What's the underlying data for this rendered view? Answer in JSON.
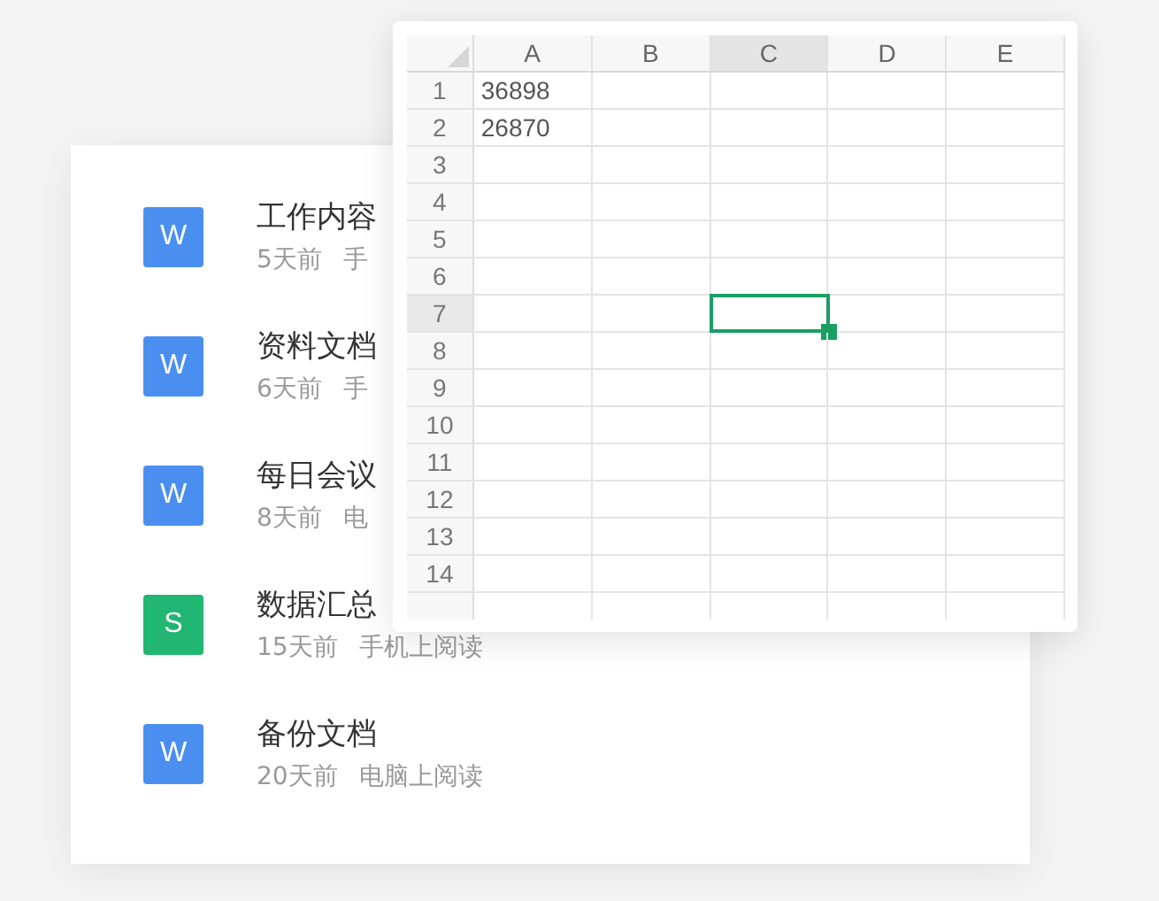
{
  "files": [
    {
      "badge": "W",
      "color": "#4a8ff0",
      "title": "工作内容",
      "time": "5天前",
      "source": "手"
    },
    {
      "badge": "W",
      "color": "#4a8ff0",
      "title": "资料文档",
      "time": "6天前",
      "source": "手"
    },
    {
      "badge": "W",
      "color": "#4a8ff0",
      "title": "每日会议",
      "time": "8天前",
      "source": "电"
    },
    {
      "badge": "S",
      "color": "#21b672",
      "title": "数据汇总",
      "time": "15天前",
      "source": "手机上阅读"
    },
    {
      "badge": "W",
      "color": "#4a8ff0",
      "title": "备份文档",
      "time": "20天前",
      "source": "电脑上阅读"
    }
  ],
  "sheet": {
    "columns": [
      {
        "label": "A",
        "selected": false
      },
      {
        "label": "B",
        "selected": false
      },
      {
        "label": "C",
        "selected": true
      },
      {
        "label": "D",
        "selected": false
      },
      {
        "label": "E",
        "selected": false
      }
    ],
    "rows": [
      {
        "label": "1",
        "selected": false,
        "cells": [
          "36898"
        ]
      },
      {
        "label": "2",
        "selected": false,
        "cells": [
          "26870"
        ]
      },
      {
        "label": "3",
        "selected": false
      },
      {
        "label": "4",
        "selected": false
      },
      {
        "label": "5",
        "selected": false
      },
      {
        "label": "6",
        "selected": false
      },
      {
        "label": "7",
        "selected": true
      },
      {
        "label": "8",
        "selected": false
      },
      {
        "label": "9",
        "selected": false
      },
      {
        "label": "10",
        "selected": false
      },
      {
        "label": "11",
        "selected": false
      },
      {
        "label": "12",
        "selected": false
      },
      {
        "label": "13",
        "selected": false
      },
      {
        "label": "14",
        "selected": false
      }
    ]
  }
}
